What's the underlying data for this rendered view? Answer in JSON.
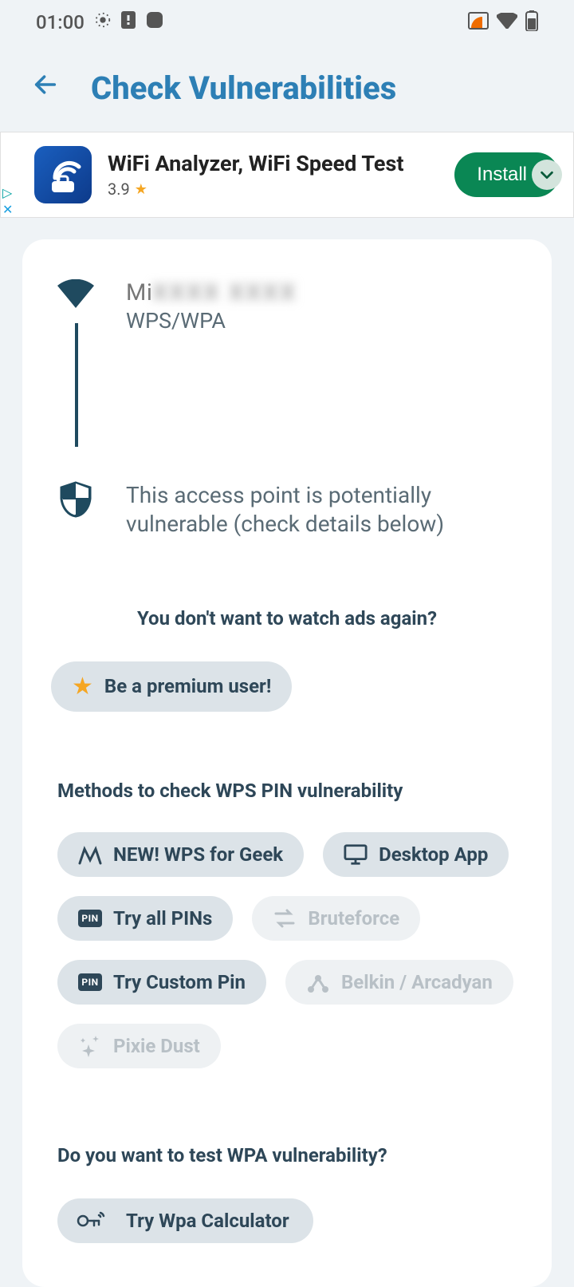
{
  "status_bar": {
    "time": "01:00"
  },
  "header": {
    "title": "Check Vulnerabilities"
  },
  "ad": {
    "title": "WiFi Analyzer, WiFi Speed Test",
    "rating": "3.9",
    "cta": "Install"
  },
  "network": {
    "name_prefix": "Mi",
    "name_masked": "XXXX XXXX",
    "security": "WPS/WPA",
    "status": "This access point is potentially vulnerable (check details below)"
  },
  "ads_prompt": "You don't want to watch ads again?",
  "premium_label": "Be a premium user!",
  "methods_heading": "Methods to check WPS PIN vulnerability",
  "methods": {
    "wps_geek": "NEW! WPS for Geek",
    "desktop": "Desktop App",
    "try_all": "Try all PINs",
    "bruteforce": "Bruteforce",
    "custom_pin": "Try Custom Pin",
    "belkin": "Belkin / Arcadyan",
    "pixie": "Pixie Dust"
  },
  "wpa_heading": "Do you want to test WPA vulnerability?",
  "wpa_chip": "Try Wpa Calculator",
  "pin_badge": "PIN"
}
